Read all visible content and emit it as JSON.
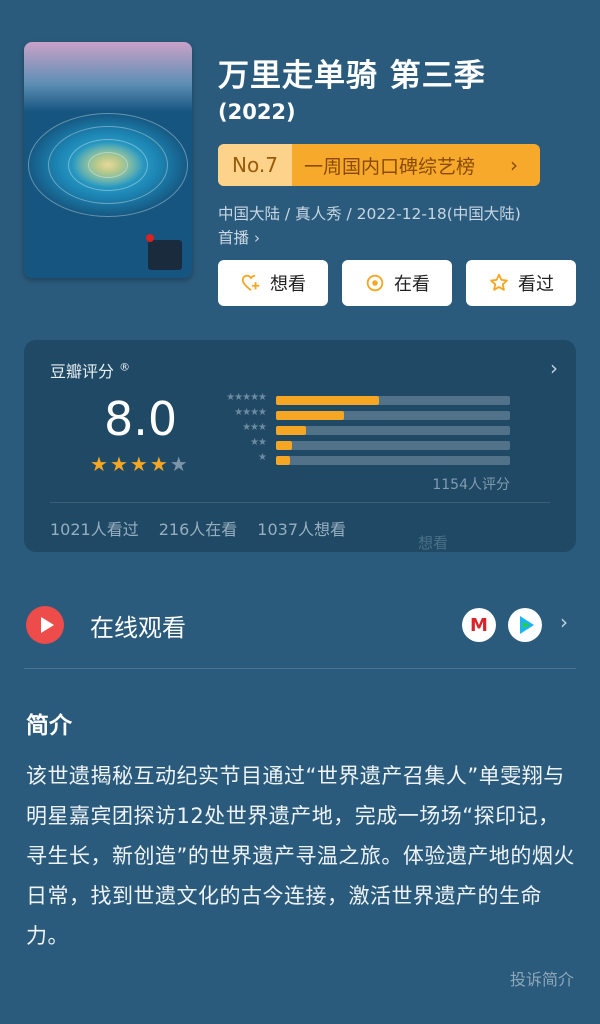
{
  "show": {
    "title": "万里走单骑 第三季",
    "year": "(2022)",
    "rank_no": "No.7",
    "rank_list": "一周国内口碑综艺榜",
    "meta_line": "中国大陆 / 真人秀 / 2022-12-18(中国大陆)",
    "meta_line2": "首播"
  },
  "actions": [
    {
      "label": "想看",
      "icon": "heart-plus-icon"
    },
    {
      "label": "在看",
      "icon": "target-icon"
    },
    {
      "label": "看过",
      "icon": "star-outline-icon"
    }
  ],
  "rating": {
    "label": "豆瓣评分",
    "trademark": "®",
    "score": "8.0",
    "stars_filled": 4,
    "stars_total": 5,
    "distribution": [
      {
        "stars": 5,
        "fraction": 0.44
      },
      {
        "stars": 4,
        "fraction": 0.29
      },
      {
        "stars": 3,
        "fraction": 0.13
      },
      {
        "stars": 2,
        "fraction": 0.07
      },
      {
        "stars": 1,
        "fraction": 0.06
      }
    ],
    "votes": "1154人评分",
    "stats": [
      "1021人看过",
      "216人在看",
      "1037人想看"
    ],
    "watermark": "想看"
  },
  "watch": {
    "label": "在线观看",
    "apps": [
      "M",
      "play"
    ]
  },
  "intro": {
    "title": "简介",
    "body": "该世遗揭秘互动纪实节目通过“世界遗产召集人”单雯翔与明星嘉宾团探访12处世界遗产地，完成一场场“探印记，寻生长，新创造”的世界遗产寻温之旅。体验遗产地的烟火日常，找到世遗文化的古今连接，激活世界遗产的生命力。",
    "report": "投诉简介"
  },
  "colors": {
    "background": "#2b5b7c",
    "accent": "#f5a623",
    "play_red": "#ee4b4b"
  }
}
